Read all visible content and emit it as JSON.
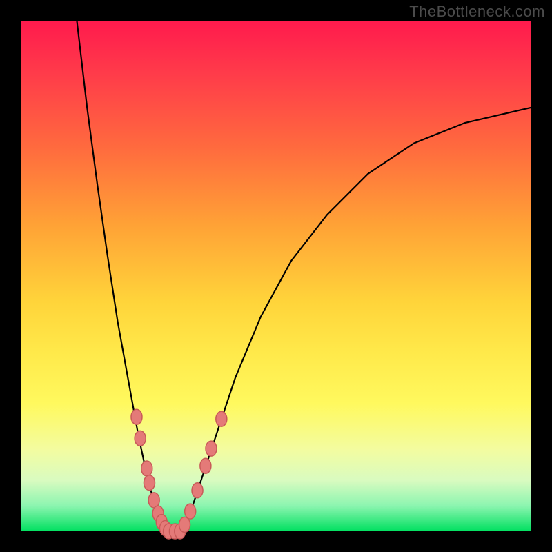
{
  "attribution": "TheBottleneck.com",
  "gradient_colors": {
    "top": "#ff1a4d",
    "mid_upper": "#ffa236",
    "mid": "#ffe94a",
    "lower": "#d9fbc0",
    "bottom": "#00e060"
  },
  "chart_data": {
    "type": "line",
    "title": "",
    "xlabel": "",
    "ylabel": "",
    "xlim": [
      0,
      100
    ],
    "ylim": [
      0,
      100
    ],
    "note": "No axis ticks, labels, or legend are visible. The curve appears to be a V-shaped bottleneck profile on a red-to-green gradient, with scatter markers clustered near the valley floor on both branches.",
    "series": [
      {
        "name": "curve-left-branch",
        "x": [
          11,
          13,
          15,
          17,
          19,
          21,
          23,
          24.5,
          26,
          27.5,
          28.5
        ],
        "y": [
          100,
          83,
          68,
          54,
          41,
          30,
          19,
          12,
          6,
          2,
          0
        ]
      },
      {
        "name": "curve-valley",
        "x": [
          28.5,
          30,
          31.5
        ],
        "y": [
          0,
          0,
          0
        ]
      },
      {
        "name": "curve-right-branch",
        "x": [
          31.5,
          33,
          35,
          38,
          42,
          47,
          53,
          60,
          68,
          77,
          87,
          100
        ],
        "y": [
          0,
          3,
          9,
          18,
          30,
          42,
          53,
          62,
          70,
          76,
          80,
          83
        ]
      }
    ],
    "scatter": [
      {
        "name": "left-branch-markers",
        "x": [
          22.7,
          23.4,
          24.7,
          25.2,
          26.1,
          26.9,
          27.6,
          28.3
        ],
        "y": [
          22.4,
          18.2,
          12.3,
          9.5,
          6.1,
          3.5,
          1.8,
          0.6
        ]
      },
      {
        "name": "valley-markers",
        "x": [
          29.0,
          30.2,
          31.2
        ],
        "y": [
          0,
          0,
          0
        ]
      },
      {
        "name": "right-branch-markers",
        "x": [
          32.1,
          33.2,
          34.6,
          36.2,
          37.3,
          39.3
        ],
        "y": [
          1.3,
          3.9,
          8.0,
          12.8,
          16.2,
          22.0
        ]
      }
    ]
  }
}
